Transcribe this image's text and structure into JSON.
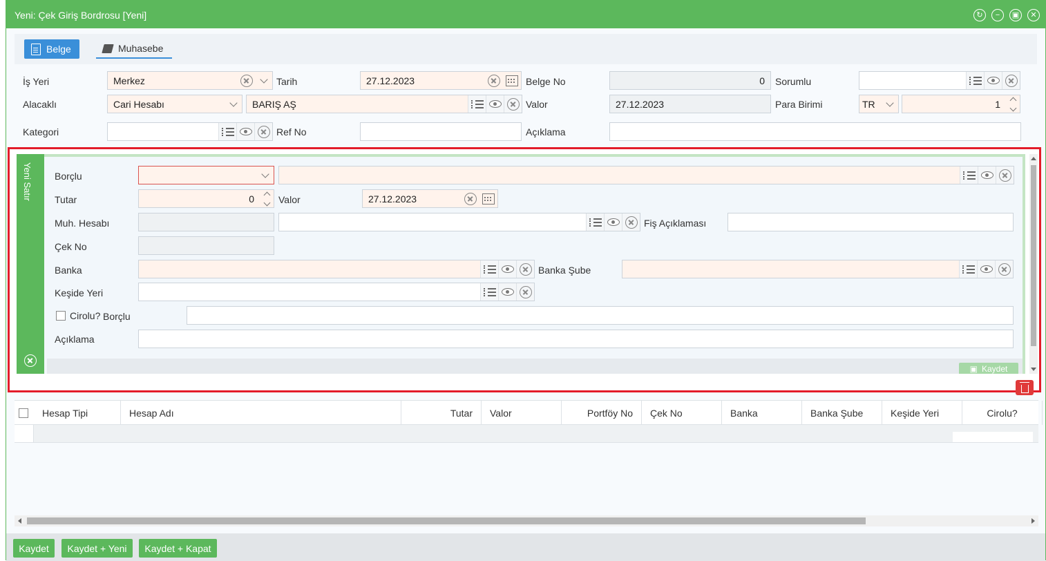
{
  "window": {
    "title": "Yeni: Çek Giriş Bordrosu [Yeni]"
  },
  "tabs": [
    {
      "label": "Belge",
      "active": true,
      "icon": "document-icon"
    },
    {
      "label": "Muhasebe",
      "active": false,
      "icon": "book-icon"
    }
  ],
  "header": {
    "is_yeri": {
      "label": "İş Yeri",
      "value": "Merkez"
    },
    "tarih": {
      "label": "Tarih",
      "value": "27.12.2023"
    },
    "belge_no": {
      "label": "Belge No",
      "value": "0"
    },
    "sorumlu": {
      "label": "Sorumlu",
      "value": ""
    },
    "alacakli": {
      "label": "Alacaklı",
      "type_value": "Cari Hesabı",
      "value": "BARIŞ AŞ"
    },
    "valor": {
      "label": "Valor",
      "value": "27.12.2023"
    },
    "para_birimi": {
      "label": "Para Birimi",
      "currency": "TR",
      "rate": "1"
    },
    "kategori": {
      "label": "Kategori",
      "value": ""
    },
    "ref_no": {
      "label": "Ref No",
      "value": ""
    },
    "aciklama": {
      "label": "Açıklama",
      "value": ""
    }
  },
  "detail": {
    "side_title": "Yeni Satır",
    "borclu": {
      "label": "Borçlu",
      "value": ""
    },
    "tutar": {
      "label": "Tutar",
      "value": "0"
    },
    "valor": {
      "label": "Valor",
      "value": "27.12.2023"
    },
    "muh_hesabi": {
      "label": "Muh. Hesabı",
      "value": ""
    },
    "fis_aciklamasi": {
      "label": "Fiş Açıklaması",
      "value": ""
    },
    "cek_no": {
      "label": "Çek No",
      "value": ""
    },
    "banka": {
      "label": "Banka",
      "value": ""
    },
    "banka_sube": {
      "label": "Banka Şube",
      "value": ""
    },
    "keside_yeri": {
      "label": "Keşide Yeri",
      "value": ""
    },
    "cirolu": {
      "label": "Cirolu?",
      "checked": false
    },
    "cirolu_borclu": {
      "label": "Borçlu",
      "value": ""
    },
    "aciklama": {
      "label": "Açıklama",
      "value": ""
    },
    "save_label": "Kaydet"
  },
  "grid": {
    "columns": [
      "Hesap Tipi",
      "Hesap Adı",
      "Tutar",
      "Valor",
      "Portföy No",
      "Çek No",
      "Banka",
      "Banka Şube",
      "Keşide Yeri",
      "Cirolu?"
    ],
    "rows": []
  },
  "footer": {
    "buttons": [
      "Kaydet",
      "Kaydet + Yeni",
      "Kaydet + Kapat"
    ]
  },
  "colors": {
    "accent_green": "#5cb85c",
    "tab_blue": "#3a8fd9",
    "highlight_red": "#e31c2a",
    "required_bg": "#fff3ec"
  }
}
